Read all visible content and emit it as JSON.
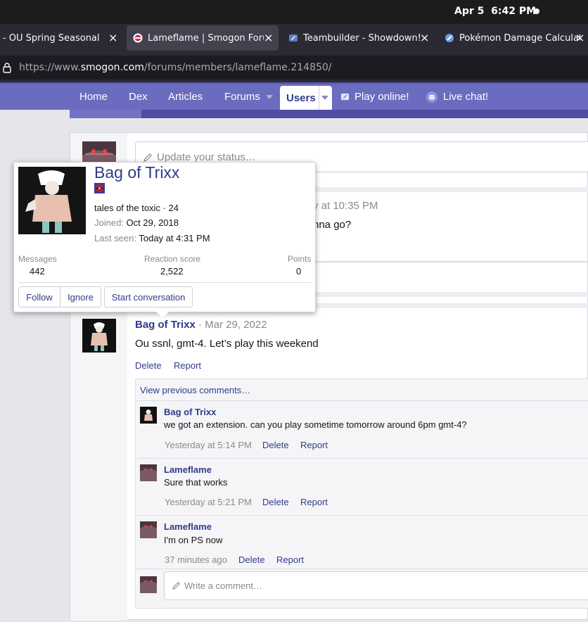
{
  "os": {
    "date": "Apr 5",
    "time": "6:42 PM"
  },
  "tabs": [
    {
      "label": "J - OU Spring Seasonal - F",
      "active": false
    },
    {
      "label": "Lameflame | Smogon Forum",
      "active": true
    },
    {
      "label": "Teambuilder - Showdown!",
      "active": false
    },
    {
      "label": "Pokémon Damage Calculator",
      "active": false
    }
  ],
  "url": {
    "prefix": "https://www.",
    "domain": "smogon.com",
    "path": "/forums/members/lameflame.214850/"
  },
  "nav": {
    "items": [
      "Home",
      "Dex",
      "Articles",
      "Forums",
      "Users",
      "Play online!",
      "Live chat!"
    ],
    "active": "Users"
  },
  "profile": {
    "status_placeholder": "Update your status…",
    "partial_post_time": "y at 10:35 PM",
    "partial_post_body": "nna go?"
  },
  "post": {
    "author": "Bag of Trixx",
    "date": "· Mar 29, 2022",
    "body": "Ou ssnl, gmt-4. Let’s play this weekend",
    "delete": "Delete",
    "report": "Report"
  },
  "comments": {
    "view_previous": "View previous comments…",
    "items": [
      {
        "author": "Bag of Trixx",
        "body": "we got an extension. can you play sometime tomorrow around 6pm gmt-4?",
        "time": "Yesterday at 5:14 PM",
        "delete": "Delete",
        "report": "Report"
      },
      {
        "author": "Lameflame",
        "body": "Sure that works",
        "time": "Yesterday at 5:21 PM",
        "delete": "Delete",
        "report": "Report"
      },
      {
        "author": "Lameflame",
        "body": "I'm on PS now",
        "time": "37 minutes ago",
        "delete": "Delete",
        "report": "Report"
      }
    ],
    "write_placeholder": "Write a comment…"
  },
  "tooltip": {
    "name": "Bag of Trixx",
    "tagline": "tales of the toxic · 24",
    "joined_label": "Joined:",
    "joined": "Oct 29, 2018",
    "last_seen_label": "Last seen:",
    "last_seen": "Today at 4:31 PM",
    "stats": [
      {
        "label": "Messages",
        "value": "442"
      },
      {
        "label": "Reaction score",
        "value": "2,522"
      },
      {
        "label": "Points",
        "value": "0"
      }
    ],
    "buttons": {
      "follow": "Follow",
      "ignore": "Ignore",
      "conversation": "Start conversation"
    }
  },
  "colors": {
    "accent": "#2f3b8a",
    "nav_bg": "#6b6bbf",
    "browser_bg": "#2b2a33"
  }
}
